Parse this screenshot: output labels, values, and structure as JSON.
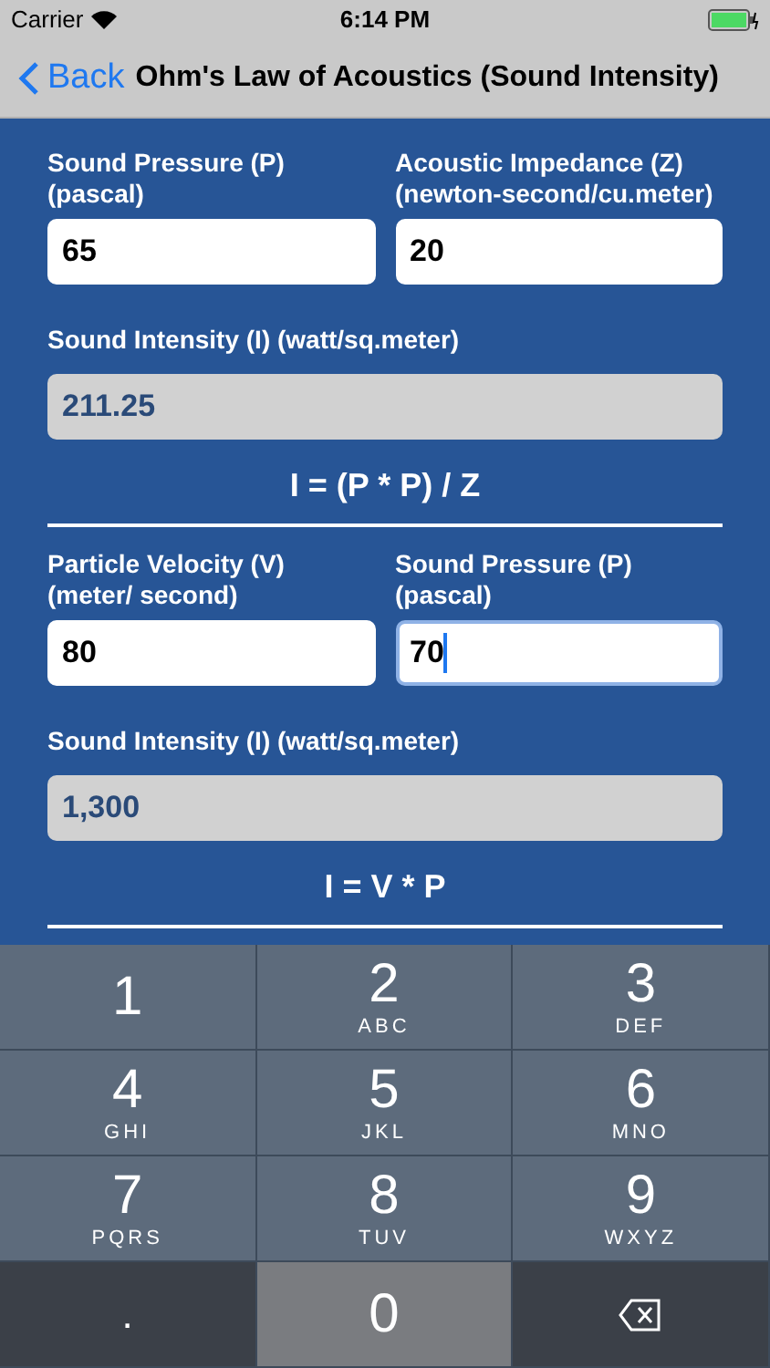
{
  "status_bar": {
    "carrier": "Carrier",
    "time": "6:14 PM"
  },
  "nav_bar": {
    "back": "Back",
    "title": "Ohm's Law of Acoustics (Sound Intensity)"
  },
  "sections": [
    {
      "inputs": [
        {
          "label": "Sound Pressure (P) (pascal)",
          "value": "65",
          "focused": false
        },
        {
          "label": "Acoustic Impedance (Z) (newton-second/cu.meter)",
          "value": "20",
          "focused": false
        }
      ],
      "result": {
        "label": "Sound Intensity (I) (watt/sq.meter)",
        "value": "211.25"
      },
      "formula": "I = (P * P) / Z"
    },
    {
      "inputs": [
        {
          "label": "Particle Velocity (V) (meter/ second)",
          "value": "80",
          "focused": false
        },
        {
          "label": "Sound Pressure (P) (pascal)",
          "value": "70",
          "focused": true
        }
      ],
      "result": {
        "label": "Sound Intensity (I) (watt/sq.meter)",
        "value": "1,300"
      },
      "formula": "I = V * P"
    }
  ],
  "keyboard": [
    {
      "kind": "digit",
      "key": "1"
    },
    {
      "kind": "digit",
      "key": "2",
      "letters": "ABC"
    },
    {
      "kind": "digit",
      "key": "3",
      "letters": "DEF"
    },
    {
      "kind": "digit",
      "key": "4",
      "letters": "GHI"
    },
    {
      "kind": "digit",
      "key": "5",
      "letters": "JKL"
    },
    {
      "kind": "digit",
      "key": "6",
      "letters": "MNO"
    },
    {
      "kind": "digit",
      "key": "7",
      "letters": "PQRS"
    },
    {
      "kind": "digit",
      "key": "8",
      "letters": "TUV"
    },
    {
      "kind": "digit",
      "key": "9",
      "letters": "WXYZ"
    },
    {
      "kind": "symbol",
      "key": "."
    },
    {
      "kind": "digit",
      "key": "0"
    },
    {
      "kind": "delete"
    }
  ]
}
